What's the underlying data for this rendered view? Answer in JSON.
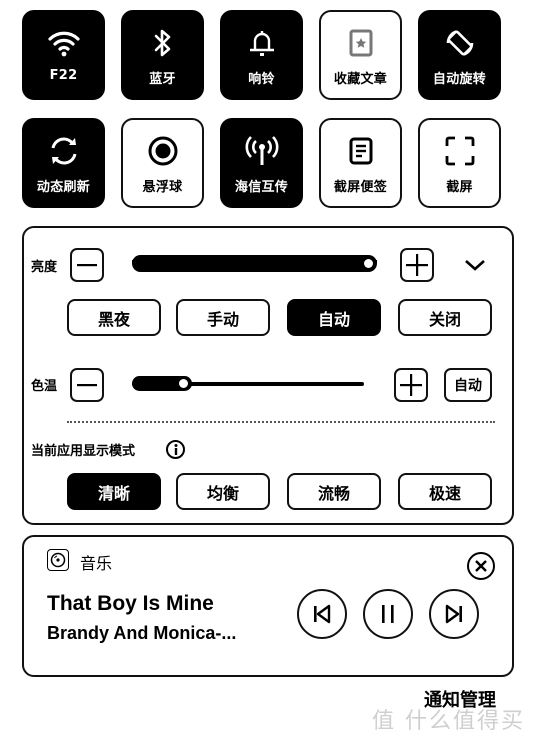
{
  "quick_tiles": [
    {
      "label": "F22",
      "icon": "wifi-icon",
      "active": true
    },
    {
      "label": "蓝牙",
      "icon": "bluetooth-icon",
      "active": true
    },
    {
      "label": "响铃",
      "icon": "bell-icon",
      "active": true
    },
    {
      "label": "收藏文章",
      "icon": "star-bookmark-icon",
      "active": false,
      "disabled": true
    },
    {
      "label": "自动旋转",
      "icon": "auto-rotate-icon",
      "active": true
    },
    {
      "label": "动态刷新",
      "icon": "refresh-icon",
      "active": true
    },
    {
      "label": "悬浮球",
      "icon": "floating-ball-icon",
      "active": false
    },
    {
      "label": "海信互传",
      "icon": "antenna-icon",
      "active": true
    },
    {
      "label": "截屏便签",
      "icon": "note-icon",
      "active": false
    },
    {
      "label": "截屏",
      "icon": "screenshot-icon",
      "active": false
    }
  ],
  "display_panel": {
    "brightness": {
      "label": "亮度",
      "value_fraction": 1.0,
      "modes": [
        {
          "label": "黑夜",
          "selected": false
        },
        {
          "label": "手动",
          "selected": false
        },
        {
          "label": "自动",
          "selected": true
        },
        {
          "label": "关闭",
          "selected": false
        }
      ]
    },
    "color_temp": {
      "label": "色温",
      "value_fraction": 0.26,
      "auto_label": "自动"
    },
    "display_mode": {
      "label": "当前应用显示模式",
      "modes": [
        {
          "label": "清晰",
          "selected": true
        },
        {
          "label": "均衡",
          "selected": false
        },
        {
          "label": "流畅",
          "selected": false
        },
        {
          "label": "极速",
          "selected": false
        }
      ]
    }
  },
  "music": {
    "app_label": "音乐",
    "title": "That Boy Is Mine",
    "artist": "Brandy And Monica-..."
  },
  "footer": {
    "notification_manage": "通知管理",
    "watermark": "值 什么值得买"
  }
}
